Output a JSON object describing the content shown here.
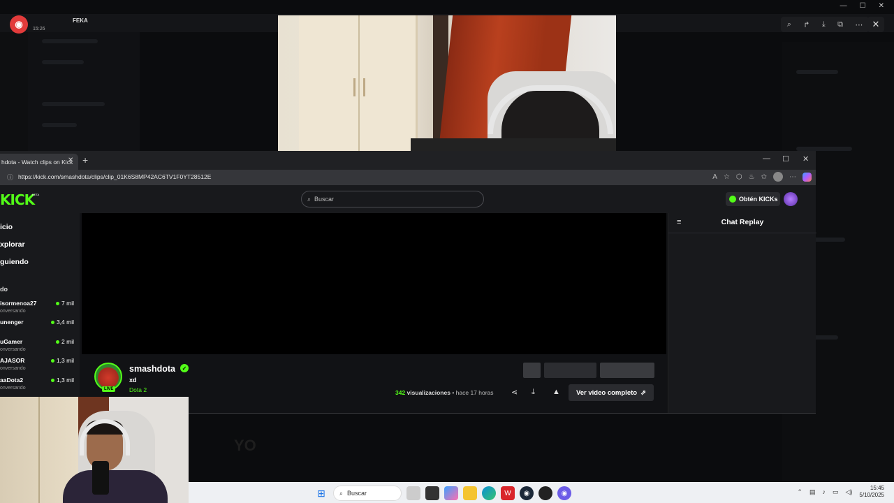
{
  "overlay": {
    "time": "15:26",
    "user": "FEKA",
    "ghost_text": "YO"
  },
  "browser": {
    "tab_title": "hdota - Watch clips on Kick",
    "url": "https://kick.com/smashdota/clips/clip_01K6S8MP42AC6TV1F0YT28512E"
  },
  "kick": {
    "logo": "KICK",
    "beta": "BETA",
    "search_placeholder": "Buscar",
    "kicks_button": "Obtén KICKs",
    "nav": [
      "icio",
      "xplorar",
      "guiendo"
    ],
    "section": "do",
    "channels": [
      {
        "name": "isormenoa27",
        "sub": "onversando",
        "viewers": "7 mil"
      },
      {
        "name": "unenger",
        "sub": "",
        "viewers": "3,4 mil"
      },
      {
        "name": "uGamer",
        "sub": "onversando",
        "viewers": "2 mil"
      },
      {
        "name": "AJASOR",
        "sub": "onversando",
        "viewers": "1,3 mil"
      },
      {
        "name": "aaDota2",
        "sub": "onversando",
        "viewers": "1,3 mil"
      }
    ],
    "chat_title": "Chat Replay",
    "streamer": "smashdota",
    "live_badge": "LIVE",
    "clip_title": "xd",
    "category": "Dota 2",
    "views_count": "342",
    "views_label": "visualizaciones",
    "time_ago": "• hace 17 horas",
    "full_video_button": "Ver video completo"
  },
  "taskbar": {
    "search": "Buscar",
    "time": "15:45",
    "date": "5/10/2025"
  },
  "colors": {
    "kick_green": "#53fc18",
    "background": "#111215"
  }
}
